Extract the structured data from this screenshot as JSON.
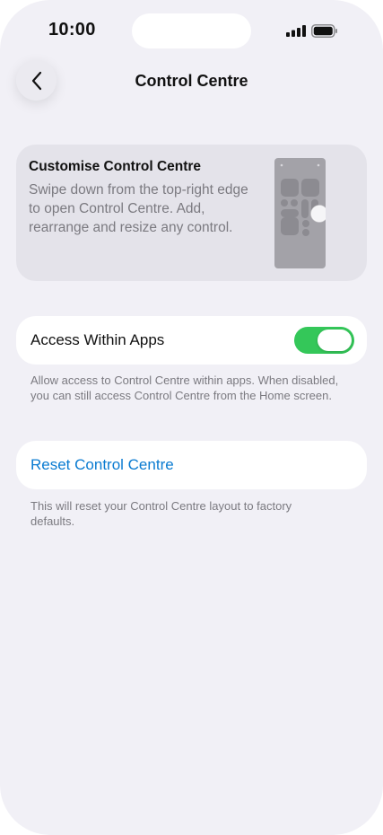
{
  "status_bar": {
    "time": "10:00",
    "signal_icon": "cellular-signal-icon",
    "battery_icon": "battery-icon"
  },
  "nav": {
    "back_icon": "chevron-left-icon",
    "title": "Control Centre"
  },
  "info_card": {
    "title": "Customise Control Centre",
    "description": "Swipe down from the top-right edge to open Control Centre. Add, rearrange and resize any control.",
    "preview_icon": "control-centre-preview-icon"
  },
  "access_within_apps": {
    "label": "Access Within Apps",
    "enabled": true,
    "toggle_color": "#34c759",
    "footnote": "Allow access to Control Centre within apps. When disabled, you can still access Control Centre from the Home screen."
  },
  "reset": {
    "label": "Reset Control Centre",
    "label_color": "#0a7bd1",
    "footnote": "This will reset your Control Centre layout to factory defaults."
  }
}
